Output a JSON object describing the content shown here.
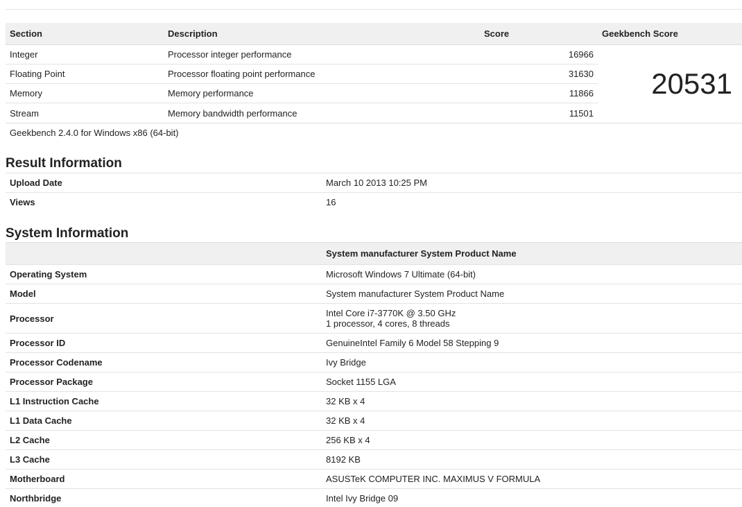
{
  "scores": {
    "headers": {
      "section": "Section",
      "description": "Description",
      "score": "Score",
      "geekbench": "Geekbench Score"
    },
    "rows": [
      {
        "section": "Integer",
        "description": "Processor integer performance",
        "score": "16966"
      },
      {
        "section": "Floating Point",
        "description": "Processor floating point performance",
        "score": "31630"
      },
      {
        "section": "Memory",
        "description": "Memory performance",
        "score": "11866"
      },
      {
        "section": "Stream",
        "description": "Memory bandwidth performance",
        "score": "11501"
      }
    ],
    "total": "20531",
    "version": "Geekbench 2.4.0 for Windows x86 (64-bit)"
  },
  "result_info": {
    "title": "Result Information",
    "rows": [
      {
        "label": "Upload Date",
        "value": "March 10 2013 10:25 PM"
      },
      {
        "label": "Views",
        "value": "16"
      }
    ]
  },
  "system_info": {
    "title": "System Information",
    "header_value": "System manufacturer System Product Name",
    "rows": [
      {
        "label": "Operating System",
        "value": "Microsoft Windows 7 Ultimate (64-bit)"
      },
      {
        "label": "Model",
        "value": "System manufacturer System Product Name"
      },
      {
        "label": "Processor",
        "value": "Intel Core i7-3770K @ 3.50 GHz",
        "value2": "1 processor, 4 cores, 8 threads"
      },
      {
        "label": "Processor ID",
        "value": "GenuineIntel Family 6 Model 58 Stepping 9"
      },
      {
        "label": "Processor Codename",
        "value": "Ivy Bridge"
      },
      {
        "label": "Processor Package",
        "value": "Socket 1155 LGA"
      },
      {
        "label": "L1 Instruction Cache",
        "value": "32 KB x 4"
      },
      {
        "label": "L1 Data Cache",
        "value": "32 KB x 4"
      },
      {
        "label": "L2 Cache",
        "value": "256 KB x 4"
      },
      {
        "label": "L3 Cache",
        "value": "8192 KB"
      },
      {
        "label": "Motherboard",
        "value": "ASUSTeK COMPUTER INC. MAXIMUS V FORMULA"
      },
      {
        "label": "Northbridge",
        "value": "Intel Ivy Bridge 09"
      }
    ]
  }
}
